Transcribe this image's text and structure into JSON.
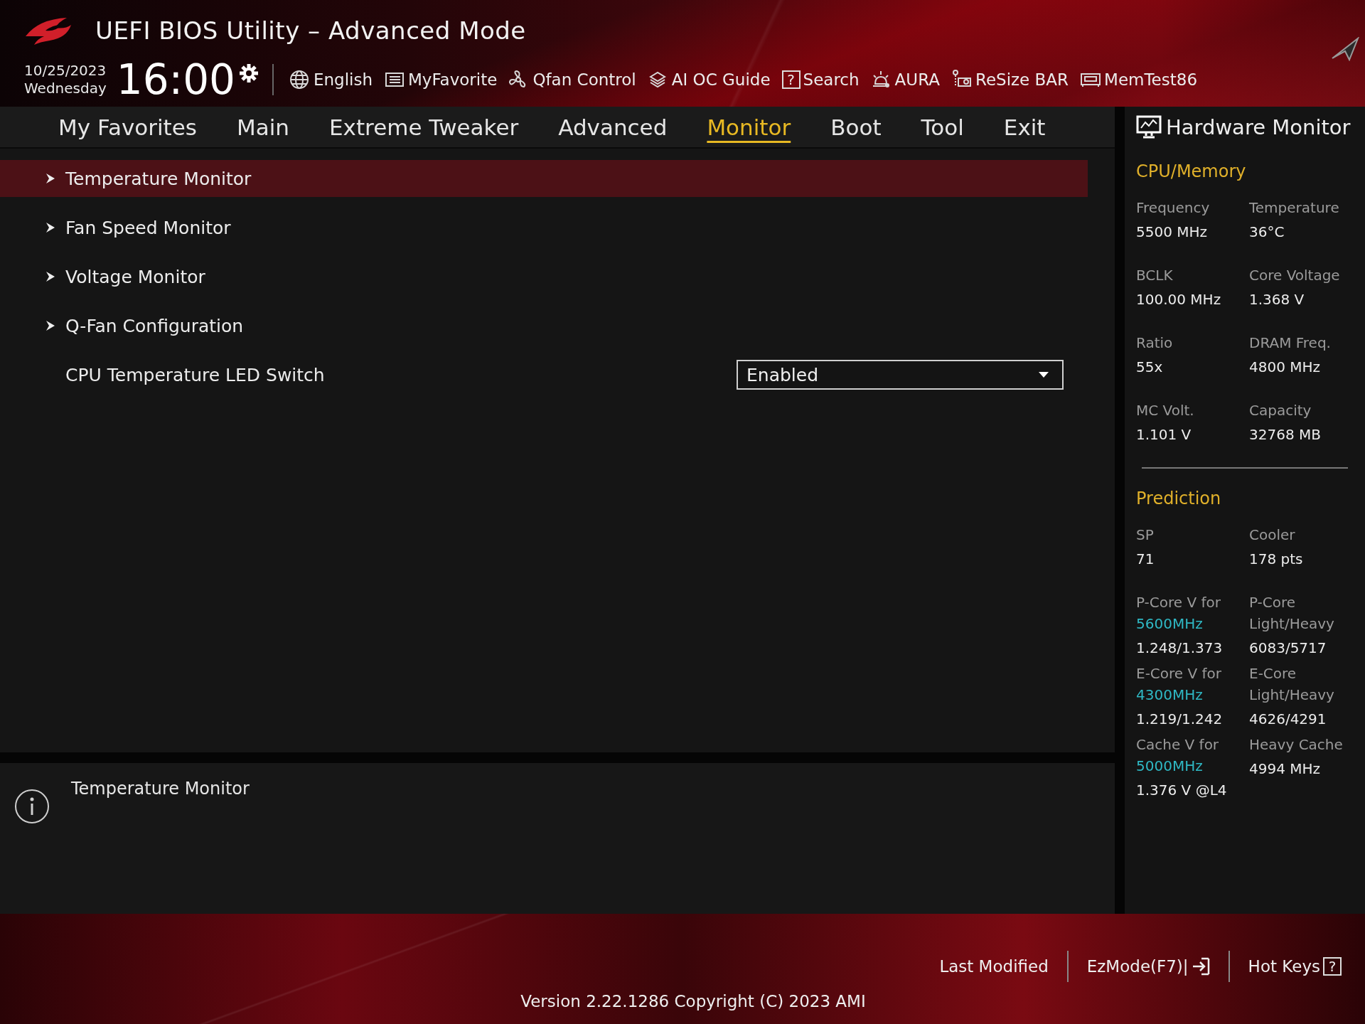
{
  "header": {
    "title": "UEFI BIOS Utility – Advanced Mode",
    "date": "10/25/2023",
    "weekday": "Wednesday",
    "time": "16:00",
    "tools": [
      {
        "label": "English"
      },
      {
        "label": "MyFavorite"
      },
      {
        "label": "Qfan Control"
      },
      {
        "label": "AI OC Guide"
      },
      {
        "label": "Search",
        "glyph": "?"
      },
      {
        "label": "AURA"
      },
      {
        "label": "ReSize BAR"
      },
      {
        "label": "MemTest86"
      }
    ]
  },
  "tabs": [
    {
      "label": "My Favorites",
      "selected": false
    },
    {
      "label": "Main",
      "selected": false
    },
    {
      "label": "Extreme Tweaker",
      "selected": false
    },
    {
      "label": "Advanced",
      "selected": false
    },
    {
      "label": "Monitor",
      "selected": true
    },
    {
      "label": "Boot",
      "selected": false
    },
    {
      "label": "Tool",
      "selected": false
    },
    {
      "label": "Exit",
      "selected": false
    }
  ],
  "menu": [
    {
      "kind": "submenu",
      "label": "Temperature Monitor",
      "selected": true
    },
    {
      "kind": "submenu",
      "label": "Fan Speed Monitor",
      "selected": false
    },
    {
      "kind": "submenu",
      "label": "Voltage Monitor",
      "selected": false
    },
    {
      "kind": "submenu",
      "label": "Q-Fan Configuration",
      "selected": false
    },
    {
      "kind": "dropdown",
      "label": "CPU Temperature LED Switch",
      "value": "Enabled",
      "selected": false
    }
  ],
  "help": {
    "text": "Temperature Monitor"
  },
  "hardware_monitor": {
    "title": "Hardware Monitor",
    "sections": [
      {
        "title": "CPU/Memory",
        "rows": [
          {
            "cells": [
              {
                "label": "Frequency",
                "value": "5500 MHz"
              },
              {
                "label": "Temperature",
                "value": "36°C"
              }
            ]
          },
          {
            "cells": [
              {
                "label": "BCLK",
                "value": "100.00 MHz"
              },
              {
                "label": "Core Voltage",
                "value": "1.368 V"
              }
            ]
          },
          {
            "cells": [
              {
                "label": "Ratio",
                "value": "55x"
              },
              {
                "label": "DRAM Freq.",
                "value": "4800 MHz"
              }
            ]
          },
          {
            "cells": [
              {
                "label": "MC Volt.",
                "value": "1.101 V"
              },
              {
                "label": "Capacity",
                "value": "32768 MB"
              }
            ]
          }
        ]
      },
      {
        "title": "Prediction",
        "rows": [
          {
            "cells": [
              {
                "label": "SP",
                "value": "71"
              },
              {
                "label": "Cooler",
                "value": "178 pts"
              }
            ]
          },
          {
            "cells": [
              {
                "label": "P-Core V for",
                "freq": "5600MHz",
                "value": "1.248/1.373"
              },
              {
                "label": "P-Core Light/Heavy",
                "value": "6083/5717"
              }
            ]
          },
          {
            "cells": [
              {
                "label": "E-Core V for",
                "freq": "4300MHz",
                "value": "1.219/1.242"
              },
              {
                "label": "E-Core Light/Heavy",
                "value": "4626/4291"
              }
            ]
          },
          {
            "cells": [
              {
                "label": "Cache V for",
                "freq": "5000MHz",
                "value": "1.376 V @L4"
              },
              {
                "label": "Heavy Cache",
                "value": "4994 MHz"
              }
            ]
          }
        ]
      }
    ]
  },
  "footer": {
    "buttons": [
      {
        "label": "Last Modified"
      },
      {
        "label": "EzMode(F7)|"
      },
      {
        "label": "Hot Keys",
        "glyph": "?"
      }
    ],
    "version": "Version 2.22.1286 Copyright (C) 2023 AMI"
  }
}
